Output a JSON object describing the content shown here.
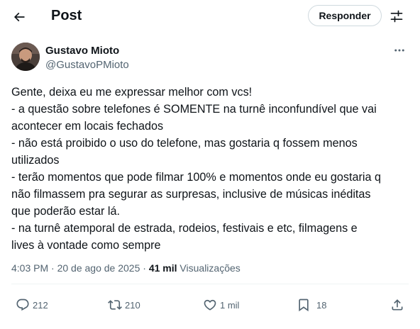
{
  "header": {
    "title": "Post",
    "reply_label": "Responder"
  },
  "author": {
    "name": "Gustavo Mioto",
    "handle": "@GustavoPMioto"
  },
  "tweet": {
    "lines": [
      "Gente, deixa eu me expressar melhor com vcs!",
      "- a questão sobre telefones é SOMENTE na turnê inconfundível que vai",
      "acontecer em locais fechados",
      "- não está proibido o uso do telefone, mas gostaria q fossem menos",
      "utilizados",
      "- terão momentos que pode filmar 100% e momentos onde eu gostaria q",
      "não filmassem pra segurar as surpresas, inclusive de músicas inéditas",
      "que poderão estar lá.",
      "- na turnê atemporal de estrada, rodeios, festivais e etc, filmagens e",
      "lives à vontade como sempre"
    ]
  },
  "meta": {
    "time": "4:03 PM",
    "separator": "·",
    "date": "20 de ago de 2025",
    "views_count": "41 mil",
    "views_label": "Visualizações"
  },
  "actions": {
    "replies": "212",
    "reposts": "210",
    "likes": "1 mil",
    "bookmarks": "18"
  },
  "icons": [
    "back-arrow-icon",
    "settings-icon",
    "more-icon",
    "reply-icon",
    "repost-icon",
    "like-icon",
    "bookmark-icon",
    "share-icon"
  ],
  "colors": {
    "text": "#0f1419",
    "secondary": "#536471",
    "border": "#cfd9de"
  }
}
